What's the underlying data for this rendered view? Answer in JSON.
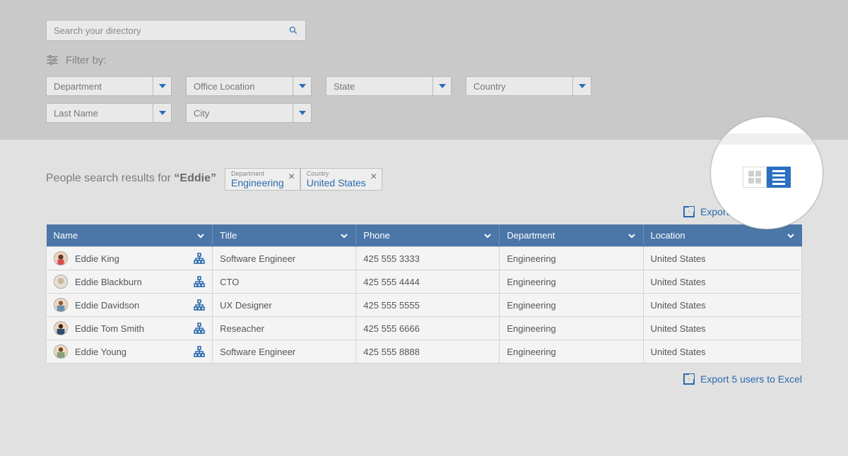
{
  "search": {
    "placeholder": "Search your directory"
  },
  "filter_label": "Filter by:",
  "filters": {
    "row1": [
      "Department",
      "Office Location",
      "State",
      "Country"
    ],
    "row2": [
      "Last Name",
      "City"
    ]
  },
  "results": {
    "prefix": "People search results for ",
    "query": "“Eddie”",
    "chips": [
      {
        "label": "Department",
        "value": "Engineering"
      },
      {
        "label": "Country",
        "value": "United States"
      }
    ]
  },
  "export_label": "Export 5 users to Excel",
  "columns": [
    "Name",
    "Title",
    "Phone",
    "Department",
    "Location"
  ],
  "rows": [
    {
      "name": "Eddie King",
      "title": "Software Engineer",
      "phone": "425 555 3333",
      "dept": "Engineering",
      "loc": "United States"
    },
    {
      "name": "Eddie Blackburn",
      "title": "CTO",
      "phone": "425 555 4444",
      "dept": "Engineering",
      "loc": "United States"
    },
    {
      "name": "Eddie Davidson",
      "title": "UX Designer",
      "phone": "425 555 5555",
      "dept": "Engineering",
      "loc": "United States"
    },
    {
      "name": "Eddie Tom Smith",
      "title": "Reseacher",
      "phone": "425 555 6666",
      "dept": "Engineering",
      "loc": "United States"
    },
    {
      "name": "Eddie Young",
      "title": "Software Engineer",
      "phone": "425 555 8888",
      "dept": "Engineering",
      "loc": "United States"
    }
  ],
  "view_toggle": {
    "grid_active": false,
    "list_active": true
  }
}
